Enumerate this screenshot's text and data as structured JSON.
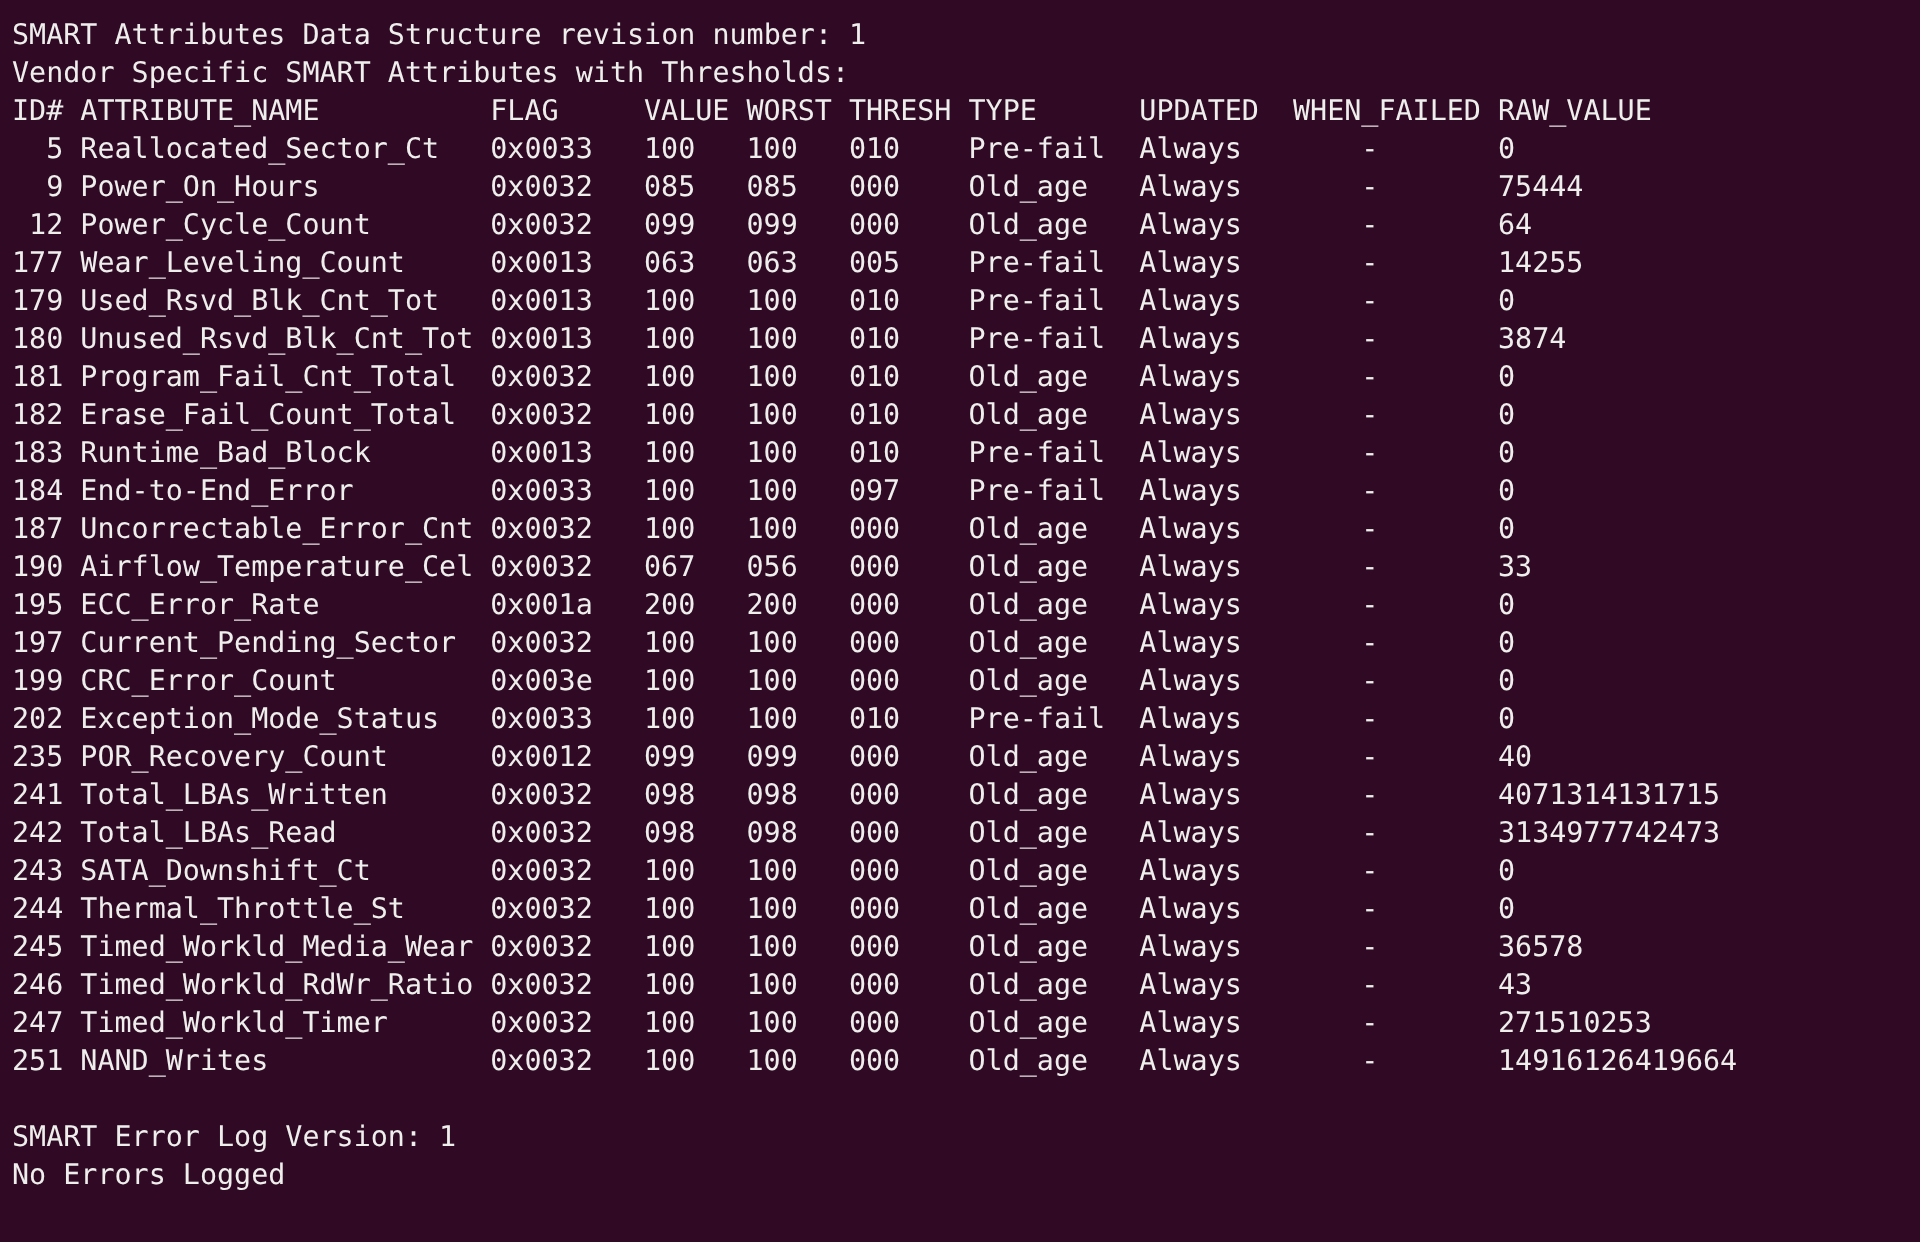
{
  "header_lines": [
    "SMART Attributes Data Structure revision number: 1",
    "Vendor Specific SMART Attributes with Thresholds:"
  ],
  "table": {
    "columns": [
      "ID#",
      "ATTRIBUTE_NAME",
      "FLAG",
      "VALUE",
      "WORST",
      "THRESH",
      "TYPE",
      "UPDATED",
      "WHEN_FAILED",
      "RAW_VALUE"
    ],
    "rows": [
      [
        "5",
        "Reallocated_Sector_Ct",
        "0x0033",
        "100",
        "100",
        "010",
        "Pre-fail",
        "Always",
        "-",
        "0"
      ],
      [
        "9",
        "Power_On_Hours",
        "0x0032",
        "085",
        "085",
        "000",
        "Old_age",
        "Always",
        "-",
        "75444"
      ],
      [
        "12",
        "Power_Cycle_Count",
        "0x0032",
        "099",
        "099",
        "000",
        "Old_age",
        "Always",
        "-",
        "64"
      ],
      [
        "177",
        "Wear_Leveling_Count",
        "0x0013",
        "063",
        "063",
        "005",
        "Pre-fail",
        "Always",
        "-",
        "14255"
      ],
      [
        "179",
        "Used_Rsvd_Blk_Cnt_Tot",
        "0x0013",
        "100",
        "100",
        "010",
        "Pre-fail",
        "Always",
        "-",
        "0"
      ],
      [
        "180",
        "Unused_Rsvd_Blk_Cnt_Tot",
        "0x0013",
        "100",
        "100",
        "010",
        "Pre-fail",
        "Always",
        "-",
        "3874"
      ],
      [
        "181",
        "Program_Fail_Cnt_Total",
        "0x0032",
        "100",
        "100",
        "010",
        "Old_age",
        "Always",
        "-",
        "0"
      ],
      [
        "182",
        "Erase_Fail_Count_Total",
        "0x0032",
        "100",
        "100",
        "010",
        "Old_age",
        "Always",
        "-",
        "0"
      ],
      [
        "183",
        "Runtime_Bad_Block",
        "0x0013",
        "100",
        "100",
        "010",
        "Pre-fail",
        "Always",
        "-",
        "0"
      ],
      [
        "184",
        "End-to-End_Error",
        "0x0033",
        "100",
        "100",
        "097",
        "Pre-fail",
        "Always",
        "-",
        "0"
      ],
      [
        "187",
        "Uncorrectable_Error_Cnt",
        "0x0032",
        "100",
        "100",
        "000",
        "Old_age",
        "Always",
        "-",
        "0"
      ],
      [
        "190",
        "Airflow_Temperature_Cel",
        "0x0032",
        "067",
        "056",
        "000",
        "Old_age",
        "Always",
        "-",
        "33"
      ],
      [
        "195",
        "ECC_Error_Rate",
        "0x001a",
        "200",
        "200",
        "000",
        "Old_age",
        "Always",
        "-",
        "0"
      ],
      [
        "197",
        "Current_Pending_Sector",
        "0x0032",
        "100",
        "100",
        "000",
        "Old_age",
        "Always",
        "-",
        "0"
      ],
      [
        "199",
        "CRC_Error_Count",
        "0x003e",
        "100",
        "100",
        "000",
        "Old_age",
        "Always",
        "-",
        "0"
      ],
      [
        "202",
        "Exception_Mode_Status",
        "0x0033",
        "100",
        "100",
        "010",
        "Pre-fail",
        "Always",
        "-",
        "0"
      ],
      [
        "235",
        "POR_Recovery_Count",
        "0x0012",
        "099",
        "099",
        "000",
        "Old_age",
        "Always",
        "-",
        "40"
      ],
      [
        "241",
        "Total_LBAs_Written",
        "0x0032",
        "098",
        "098",
        "000",
        "Old_age",
        "Always",
        "-",
        "4071314131715"
      ],
      [
        "242",
        "Total_LBAs_Read",
        "0x0032",
        "098",
        "098",
        "000",
        "Old_age",
        "Always",
        "-",
        "3134977742473"
      ],
      [
        "243",
        "SATA_Downshift_Ct",
        "0x0032",
        "100",
        "100",
        "000",
        "Old_age",
        "Always",
        "-",
        "0"
      ],
      [
        "244",
        "Thermal_Throttle_St",
        "0x0032",
        "100",
        "100",
        "000",
        "Old_age",
        "Always",
        "-",
        "0"
      ],
      [
        "245",
        "Timed_Workld_Media_Wear",
        "0x0032",
        "100",
        "100",
        "000",
        "Old_age",
        "Always",
        "-",
        "36578"
      ],
      [
        "246",
        "Timed_Workld_RdWr_Ratio",
        "0x0032",
        "100",
        "100",
        "000",
        "Old_age",
        "Always",
        "-",
        "43"
      ],
      [
        "247",
        "Timed_Workld_Timer",
        "0x0032",
        "100",
        "100",
        "000",
        "Old_age",
        "Always",
        "-",
        "271510253"
      ],
      [
        "251",
        "NAND_Writes",
        "0x0032",
        "100",
        "100",
        "000",
        "Old_age",
        "Always",
        "-",
        "14916126419664"
      ]
    ]
  },
  "footer_lines": [
    "SMART Error Log Version: 1",
    "No Errors Logged"
  ]
}
